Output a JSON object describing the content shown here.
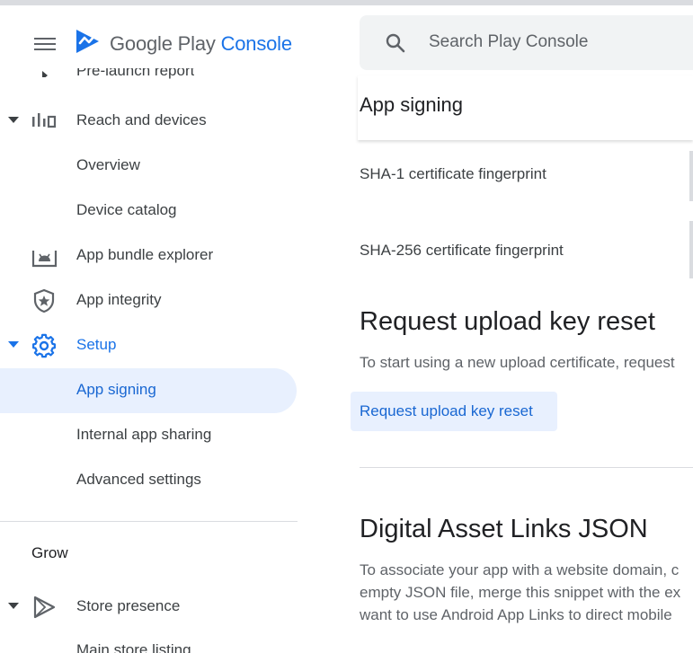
{
  "app": {
    "brand_google_play": "Google Play",
    "brand_console": "Console",
    "accent_color": "#1a73e8",
    "active_bg": "#e8f0fe"
  },
  "search": {
    "placeholder": "Search Play Console"
  },
  "sidebar": {
    "clipped_top_item": "Pre-launch report",
    "items": [
      {
        "label": "Reach and devices",
        "icon": "bar-chart-icon",
        "expanded": true
      },
      {
        "label": "Overview"
      },
      {
        "label": "Device catalog"
      },
      {
        "label": "App bundle explorer",
        "icon": "android-bundle-icon"
      },
      {
        "label": "App integrity",
        "icon": "shield-star-icon"
      },
      {
        "label": "Setup",
        "icon": "gear-icon",
        "expanded": true
      },
      {
        "label": "App signing",
        "active": true
      },
      {
        "label": "Internal app sharing"
      },
      {
        "label": "Advanced settings"
      }
    ],
    "section_grow": "Grow",
    "grow_items": [
      {
        "label": "Store presence",
        "icon": "play-triangle-icon",
        "expanded": true
      },
      {
        "label": "Main store listing"
      }
    ]
  },
  "main": {
    "page_title": "App signing",
    "sha1_label": "SHA-1 certificate fingerprint",
    "sha256_label": "SHA-256 certificate fingerprint",
    "upload_reset": {
      "heading": "Request upload key reset",
      "description": "To start using a new upload certificate, request",
      "button_label": "Request upload key reset"
    },
    "asset_links": {
      "heading": "Digital Asset Links JSON",
      "lines": [
        "To associate your app with a website domain, c",
        "empty JSON file, merge this snippet with the ex",
        "want to use Android App Links to direct mobile"
      ]
    }
  }
}
